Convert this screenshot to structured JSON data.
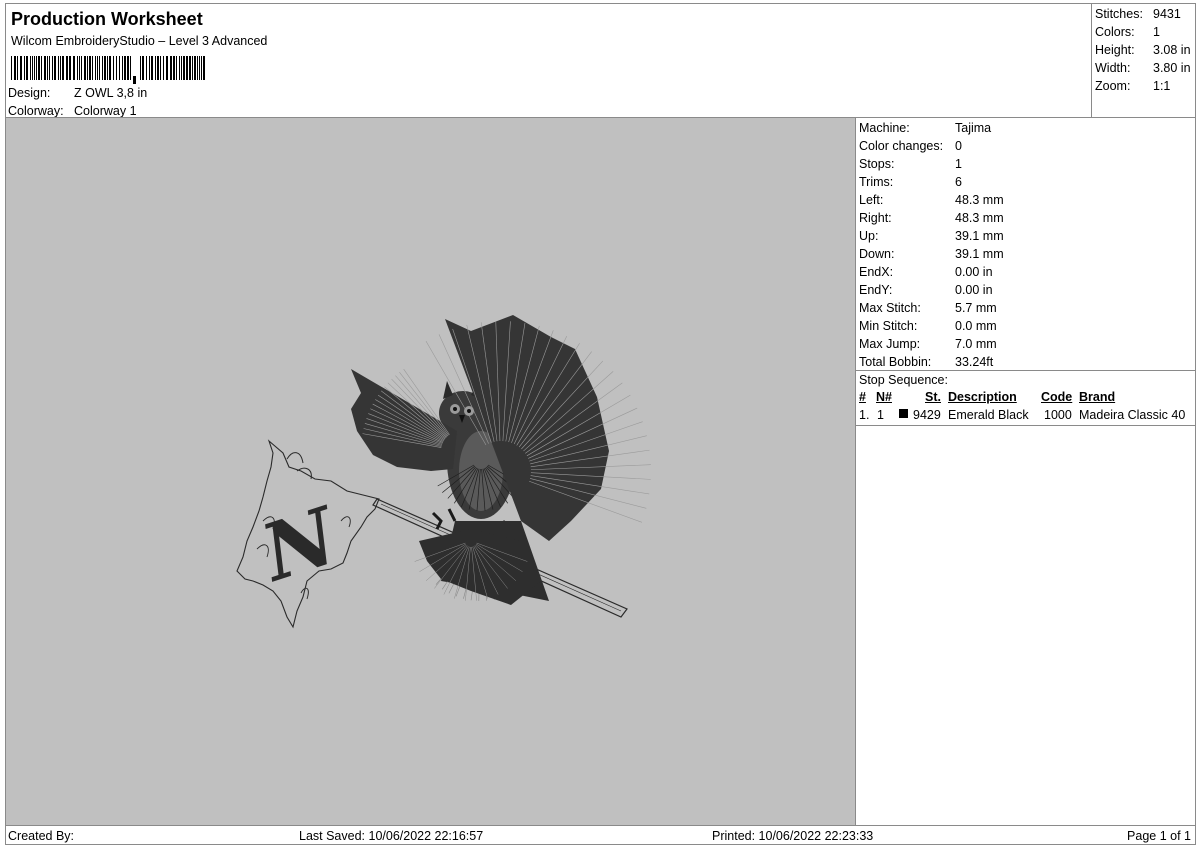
{
  "header": {
    "title": "Production Worksheet",
    "subtitle": "Wilcom EmbroideryStudio – Level 3 Advanced",
    "design_label": "Design:",
    "design_value": "Z OWL 3,8 in",
    "colorway_label": "Colorway:",
    "colorway_value": "Colorway 1"
  },
  "summary": {
    "stitches_label": "Stitches:",
    "stitches_value": "9431",
    "colors_label": "Colors:",
    "colors_value": "1",
    "height_label": "Height:",
    "height_value": "3.08 in",
    "width_label": "Width:",
    "width_value": "3.80 in",
    "zoom_label": "Zoom:",
    "zoom_value": "1:1"
  },
  "details": [
    {
      "label": "Machine:",
      "value": "Tajima"
    },
    {
      "label": "Color changes:",
      "value": "0"
    },
    {
      "label": "Stops:",
      "value": "1"
    },
    {
      "label": "Trims:",
      "value": "6"
    },
    {
      "label": "Left:",
      "value": "48.3 mm"
    },
    {
      "label": "Right:",
      "value": "48.3 mm"
    },
    {
      "label": "Up:",
      "value": "39.1 mm"
    },
    {
      "label": "Down:",
      "value": "39.1 mm"
    },
    {
      "label": "EndX:",
      "value": "0.00 in"
    },
    {
      "label": "EndY:",
      "value": "0.00 in"
    },
    {
      "label": "Max Stitch:",
      "value": "5.7 mm"
    },
    {
      "label": "Min Stitch:",
      "value": "0.0 mm"
    },
    {
      "label": "Max Jump:",
      "value": "7.0 mm"
    },
    {
      "label": "Total Bobbin:",
      "value": "33.24ft"
    }
  ],
  "stop_sequence": {
    "title": "Stop Sequence:",
    "headers": {
      "num": "#",
      "n": "N#",
      "st": "St.",
      "description": "Description",
      "code": "Code",
      "brand": "Brand"
    },
    "rows": [
      {
        "num": "1.",
        "n": "1",
        "swatch_color": "#000000",
        "st": "9429",
        "description": "Emerald Black",
        "code": "1000",
        "brand": "Madeira Classic 40"
      }
    ]
  },
  "footer": {
    "created_by": "Created By:",
    "last_saved": "Last Saved: 10/06/2022 22:16:57",
    "printed": "Printed: 10/06/2022 22:23:33",
    "page": "Page 1 of 1"
  },
  "design_preview": {
    "monogram": "N",
    "background_color": "#c0c0c0",
    "thread_color": "#2a2a2a"
  }
}
